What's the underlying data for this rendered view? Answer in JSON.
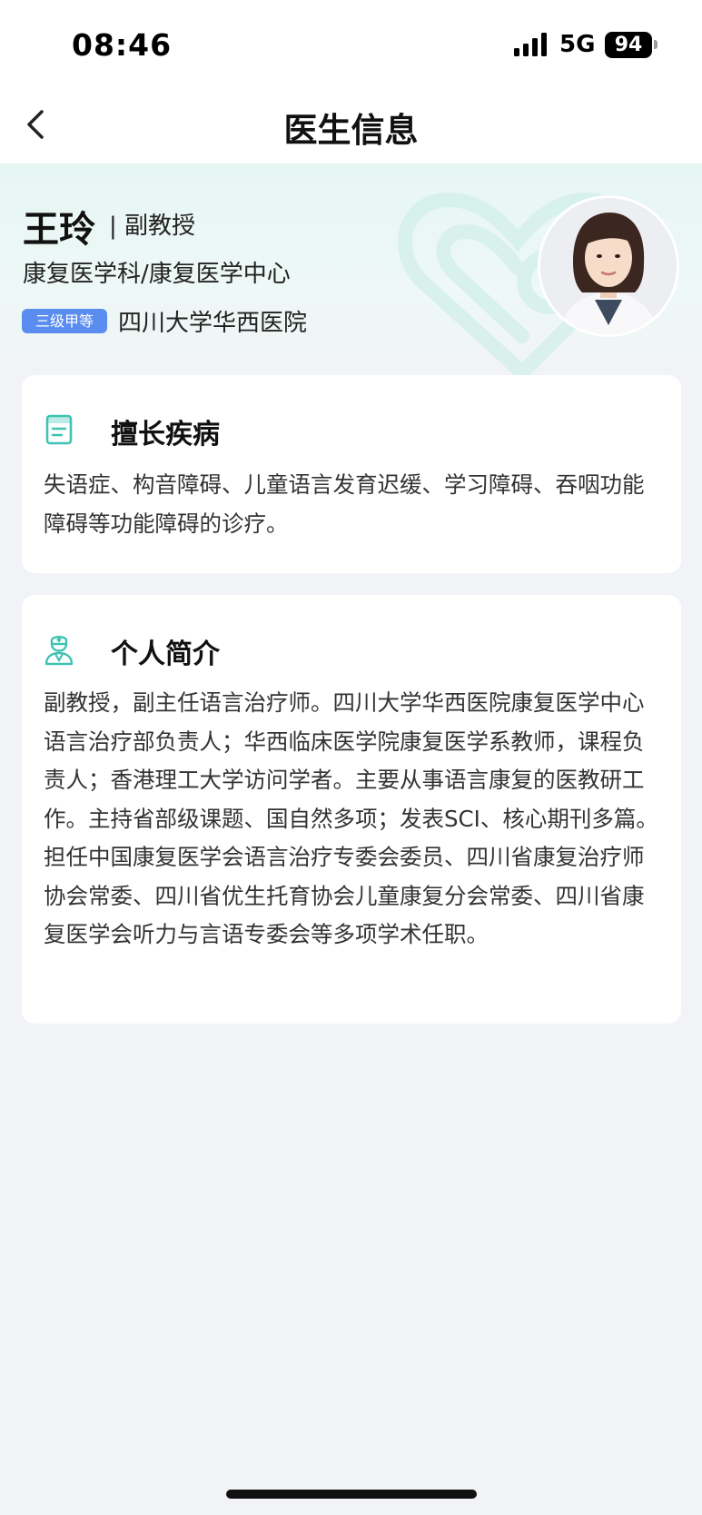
{
  "status_bar": {
    "time": "08:46",
    "network": "5G",
    "battery": "94",
    "icons": [
      "signal-icon",
      "battery-icon"
    ]
  },
  "nav": {
    "title": "医生信息",
    "back_icon": "chevron-left-icon"
  },
  "doctor": {
    "name": "王玲",
    "title": "| 副教授",
    "department": "康复医学科/康复医学中心",
    "level_badge": "三级甲等",
    "hospital": "四川大学华西医院",
    "avatar_icon": "doctor-avatar"
  },
  "specialty": {
    "title": "擅长疾病",
    "icon": "document-icon",
    "body": "失语症、构音障碍、儿童语言发育迟缓、学习障碍、吞咽功能障碍等功能障碍的诊疗。"
  },
  "profile": {
    "title": "个人简介",
    "icon": "doctor-icon",
    "body": "副教授，副主任语言治疗师。四川大学华西医院康复医学中心语言治疗部负责人；华西临床医学院康复医学系教师，课程负责人；香港理工大学访问学者。主要从事语言康复的医教研工作。主持省部级课题、国自然多项；发表SCI、核心期刊多篇。担任中国康复医学会语言治疗专委会委员、四川省康复治疗师协会常委、四川省优生托育协会儿童康复分会常委、四川省康复医学会听力与言语专委会等多项学术任职。"
  },
  "colors": {
    "accent": "#3fc2b1",
    "badge": "#5b8df0",
    "page_background": "#f1f3f7"
  }
}
